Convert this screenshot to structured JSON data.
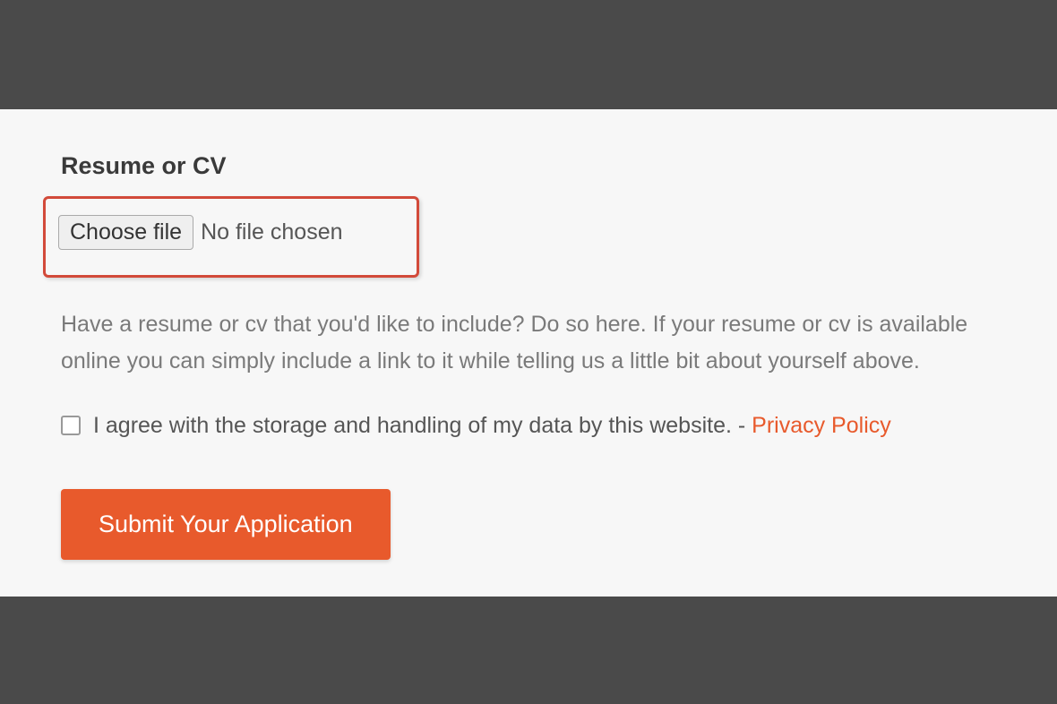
{
  "section": {
    "title": "Resume or CV"
  },
  "fileInput": {
    "buttonLabel": "Choose file",
    "status": "No file chosen"
  },
  "helpText": "Have a resume or cv that you'd like to include? Do so here. If your resume or cv is available online you can simply include a link to it while telling us a little bit about yourself above.",
  "consent": {
    "text": "I agree with the storage and handling of my data by this website. - ",
    "linkLabel": "Privacy Policy"
  },
  "submit": {
    "label": "Submit Your Application"
  }
}
